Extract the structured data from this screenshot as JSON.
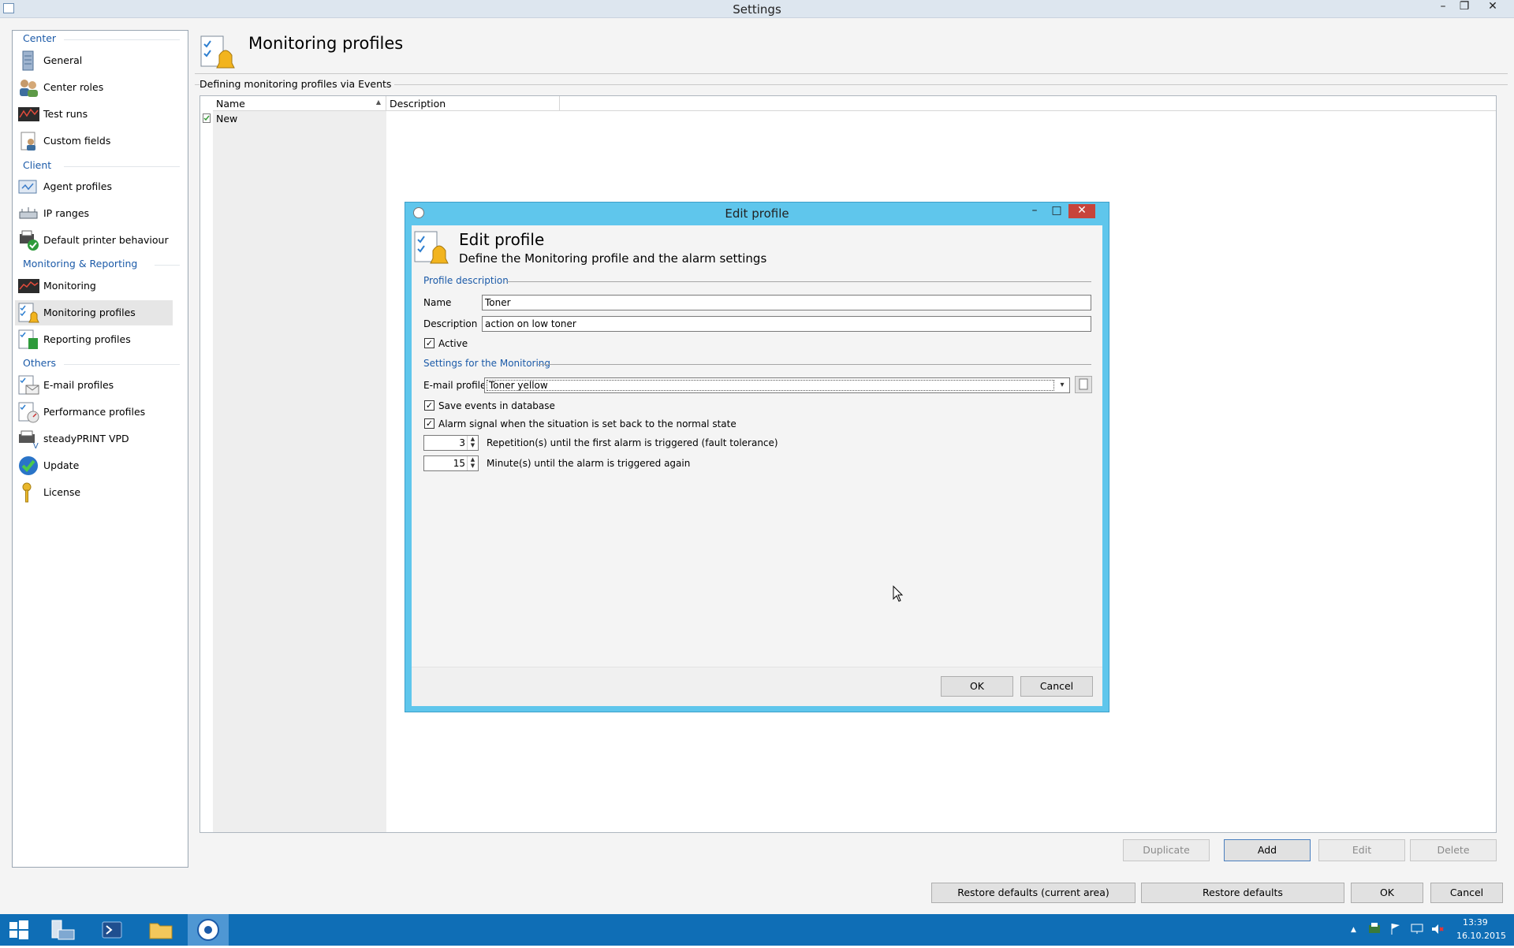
{
  "window": {
    "title": "Settings",
    "min": "–",
    "restore": "❐",
    "close": "✕"
  },
  "sidebar": {
    "sections": [
      {
        "label": "Center",
        "items": [
          {
            "label": "General",
            "icon": "server-icon"
          },
          {
            "label": "Center roles",
            "icon": "users-icon"
          },
          {
            "label": "Test runs",
            "icon": "chart-icon"
          },
          {
            "label": "Custom fields",
            "icon": "user-card-icon"
          }
        ]
      },
      {
        "label": "Client",
        "items": [
          {
            "label": "Agent profiles",
            "icon": "agent-icon"
          },
          {
            "label": "IP ranges",
            "icon": "network-icon"
          },
          {
            "label": "Default printer behaviour",
            "icon": "printer-check-icon"
          }
        ]
      },
      {
        "label": "Monitoring & Reporting",
        "items": [
          {
            "label": "Monitoring",
            "icon": "monitor-chart-icon"
          },
          {
            "label": "Monitoring profiles",
            "icon": "monitoring-profile-icon"
          },
          {
            "label": "Reporting profiles",
            "icon": "report-icon"
          }
        ]
      },
      {
        "label": "Others",
        "items": [
          {
            "label": "E-mail profiles",
            "icon": "email-icon"
          },
          {
            "label": "Performance profiles",
            "icon": "performance-icon"
          },
          {
            "label": "steadyPRINT VPD",
            "icon": "vpd-icon"
          },
          {
            "label": "Update",
            "icon": "update-icon"
          },
          {
            "label": "License",
            "icon": "key-icon"
          }
        ]
      }
    ],
    "selected": "Monitoring profiles"
  },
  "content": {
    "title": "Monitoring profiles",
    "group_label": "Defining monitoring profiles via Events",
    "columns": [
      "Name",
      "Description"
    ],
    "rows": [
      {
        "name": "New",
        "description": ""
      }
    ],
    "buttons": {
      "duplicate": "Duplicate",
      "add": "Add",
      "edit": "Edit",
      "delete": "Delete"
    }
  },
  "footer": {
    "restore_current": "Restore defaults (current area)",
    "restore_all": "Restore defaults",
    "ok": "OK",
    "cancel": "Cancel"
  },
  "dialog": {
    "title": "Edit profile",
    "heading": "Edit profile",
    "subheading": "Define the Monitoring profile and the alarm settings",
    "profile_section": "Profile description",
    "name_label": "Name",
    "name_value": "Toner",
    "description_label": "Description",
    "description_value": "action on low toner",
    "active_label": "Active",
    "active_checked": true,
    "monitoring_section": "Settings for the Monitoring",
    "email_label": "E-mail profile",
    "email_value": "Toner yellow",
    "save_events_label": "Save events in database",
    "save_events_checked": true,
    "alarm_signal_label": "Alarm signal when the situation is set back to the normal state",
    "alarm_signal_checked": true,
    "repetitions_value": "3",
    "repetitions_label": "Repetition(s) until the first alarm is triggered (fault tolerance)",
    "minutes_value": "15",
    "minutes_label": "Minute(s) until the alarm is triggered again",
    "ok": "OK",
    "cancel": "Cancel"
  },
  "taskbar": {
    "time": "13:39",
    "date": "16.10.2015"
  },
  "colors": {
    "dialog_frame": "#5fc6ec",
    "taskbar": "#0f6eb6",
    "section_blue": "#1b5aa8"
  }
}
